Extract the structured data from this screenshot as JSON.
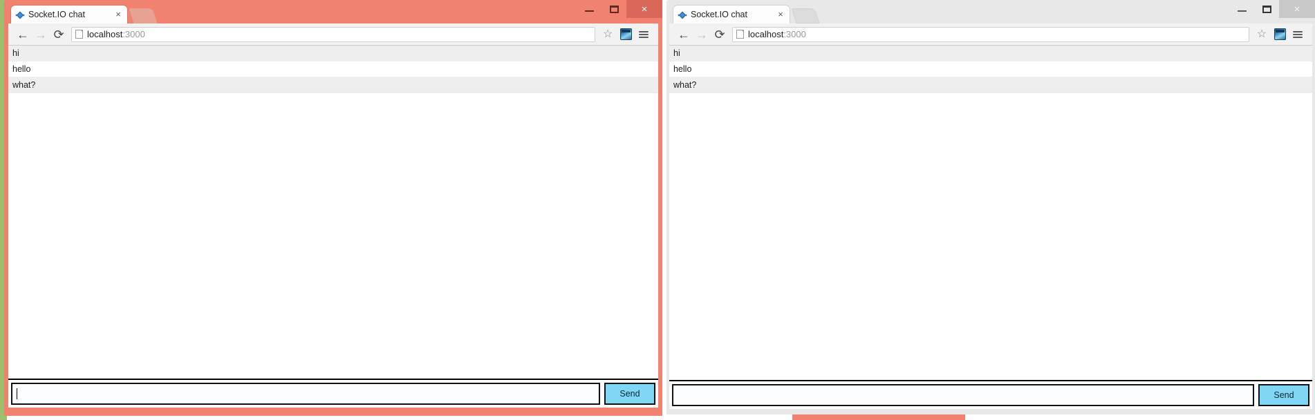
{
  "windows": [
    {
      "id": "left",
      "state": "active",
      "tab": {
        "title": "Socket.IO chat",
        "close_label": "×",
        "favicon": "socketio-favicon"
      },
      "newtab_label": "new-tab",
      "controls": {
        "minimize": "minimize",
        "maximize": "maximize",
        "close": "×"
      },
      "toolbar": {
        "back": "←",
        "forward": "→",
        "reload": "⟳",
        "url_host": "localhost",
        "url_port": ":3000",
        "bookmark": "☆",
        "extension": "extension-icon",
        "menu": "menu-icon"
      },
      "chat": {
        "messages": [
          "hi",
          "hello",
          "what?"
        ],
        "input_value": "",
        "input_placeholder": "",
        "send_label": "Send"
      }
    },
    {
      "id": "right",
      "state": "inactive",
      "tab": {
        "title": "Socket.IO chat",
        "close_label": "×",
        "favicon": "socketio-favicon"
      },
      "newtab_label": "new-tab",
      "controls": {
        "minimize": "minimize",
        "maximize": "maximize",
        "close": "×"
      },
      "toolbar": {
        "back": "←",
        "forward": "→",
        "reload": "⟳",
        "url_host": "localhost",
        "url_port": ":3000",
        "bookmark": "☆",
        "extension": "extension-icon",
        "menu": "menu-icon"
      },
      "chat": {
        "messages": [
          "hi",
          "hello",
          "what?"
        ],
        "input_value": "",
        "input_placeholder": "",
        "send_label": "Send"
      }
    }
  ],
  "colors": {
    "active_frame": "#f0826f",
    "inactive_frame": "#e8e8e8",
    "send_button": "#7fd7f5",
    "row_alt": "#eeeeee",
    "background_window_green": "#9fbf6e"
  }
}
